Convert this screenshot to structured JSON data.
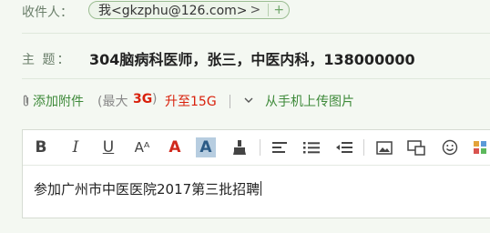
{
  "recipient": {
    "label": "收件人：",
    "chip_text": "我<gkzphu@126.com>",
    "chip_arrow": ">",
    "add_symbol": "+"
  },
  "subject": {
    "label": "主 题：",
    "value": "304脑病科医师，张三，中医内科，138000000"
  },
  "attachment": {
    "add_label": "添加附件",
    "max_open": "(最大",
    "max_value": "3G",
    "max_close": ")",
    "upgrade_label": "升至15G",
    "mobile_upload_label": "从手机上传图片"
  },
  "toolbar": {
    "bold": "B",
    "italic": "I",
    "underline": "U",
    "font_size": "Aᴬ",
    "font_color": "A",
    "highlight": "A"
  },
  "editor": {
    "body_text": "参加广州市中医医院2017第三批招聘"
  },
  "colors": {
    "accent_green": "#3e8a3a",
    "warning_red": "#d9200b",
    "background": "#f4f8f2"
  }
}
